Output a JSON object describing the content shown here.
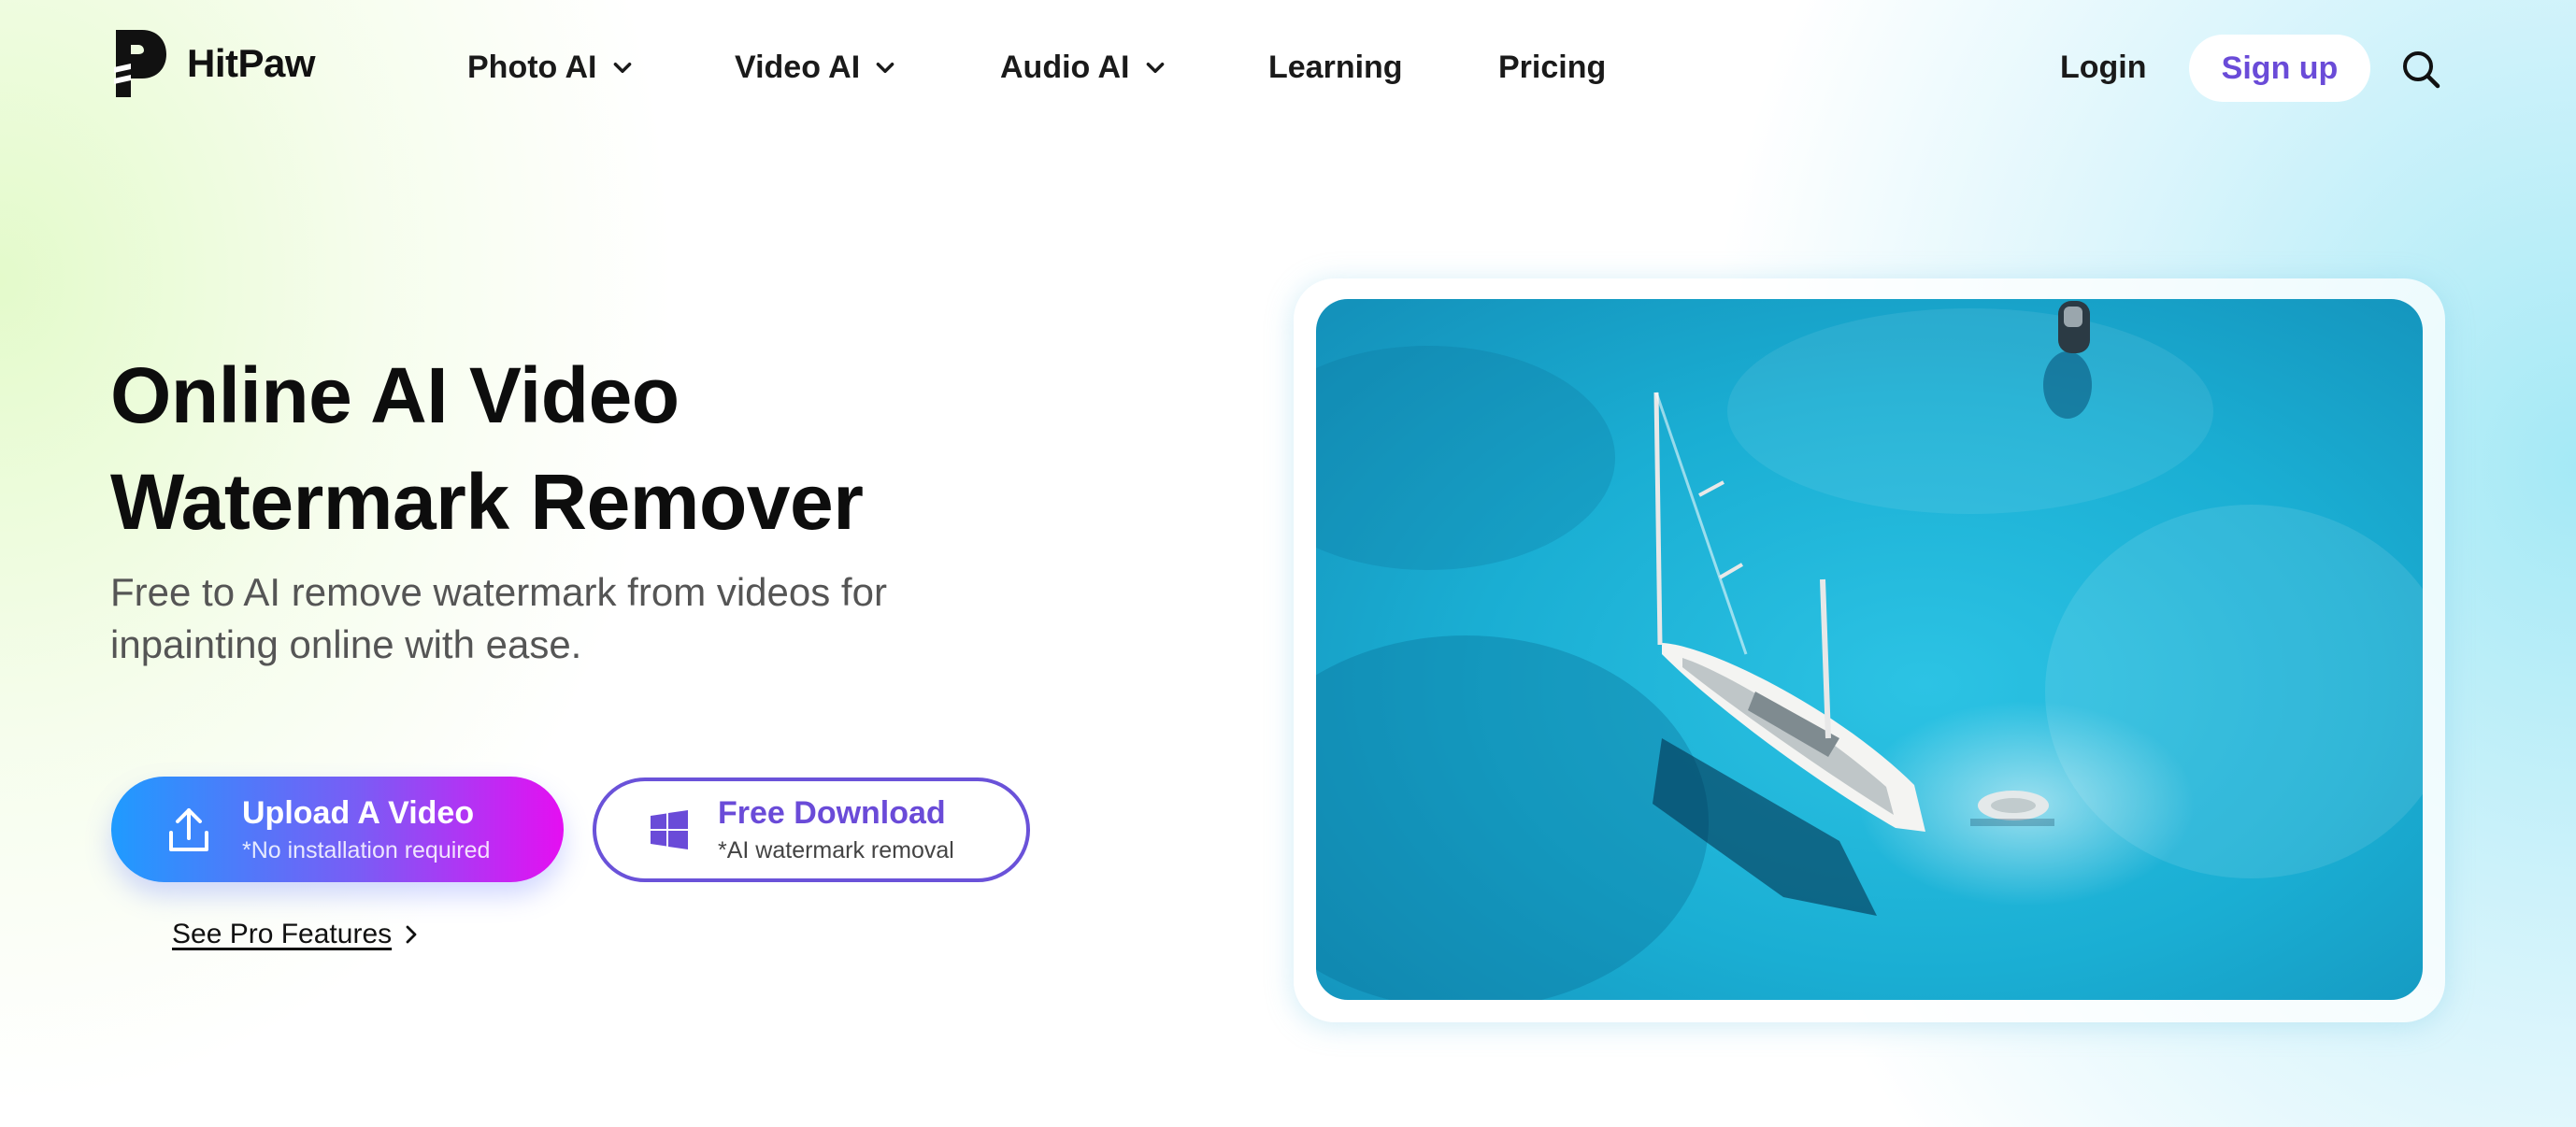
{
  "brand": {
    "name": "HitPaw"
  },
  "nav": {
    "items": [
      {
        "label": "Photo AI",
        "has_dropdown": true
      },
      {
        "label": "Video AI",
        "has_dropdown": true
      },
      {
        "label": "Audio AI",
        "has_dropdown": true
      },
      {
        "label": "Learning",
        "has_dropdown": false
      },
      {
        "label": "Pricing",
        "has_dropdown": false
      }
    ],
    "login_label": "Login",
    "signup_label": "Sign up",
    "search_icon": "search-icon"
  },
  "hero": {
    "title_line1": "Online AI Video",
    "title_line2": "Watermark Remover",
    "subtitle": "Free to AI remove watermark from videos for inpainting online with ease.",
    "upload_button": {
      "label": "Upload A Video",
      "note": "*No installation required",
      "icon": "upload-icon"
    },
    "download_button": {
      "label": "Free Download",
      "note": "*AI watermark removal",
      "icon": "windows-icon"
    },
    "pro_link": "See Pro Features"
  },
  "media": {
    "subject": "aerial view of a sailboat on turquoise sea"
  },
  "colors": {
    "accent_purple": "#6a4bd8",
    "gradient_start": "#1f9bff",
    "gradient_end": "#e50ff2",
    "sea": "#1fb0d4"
  }
}
